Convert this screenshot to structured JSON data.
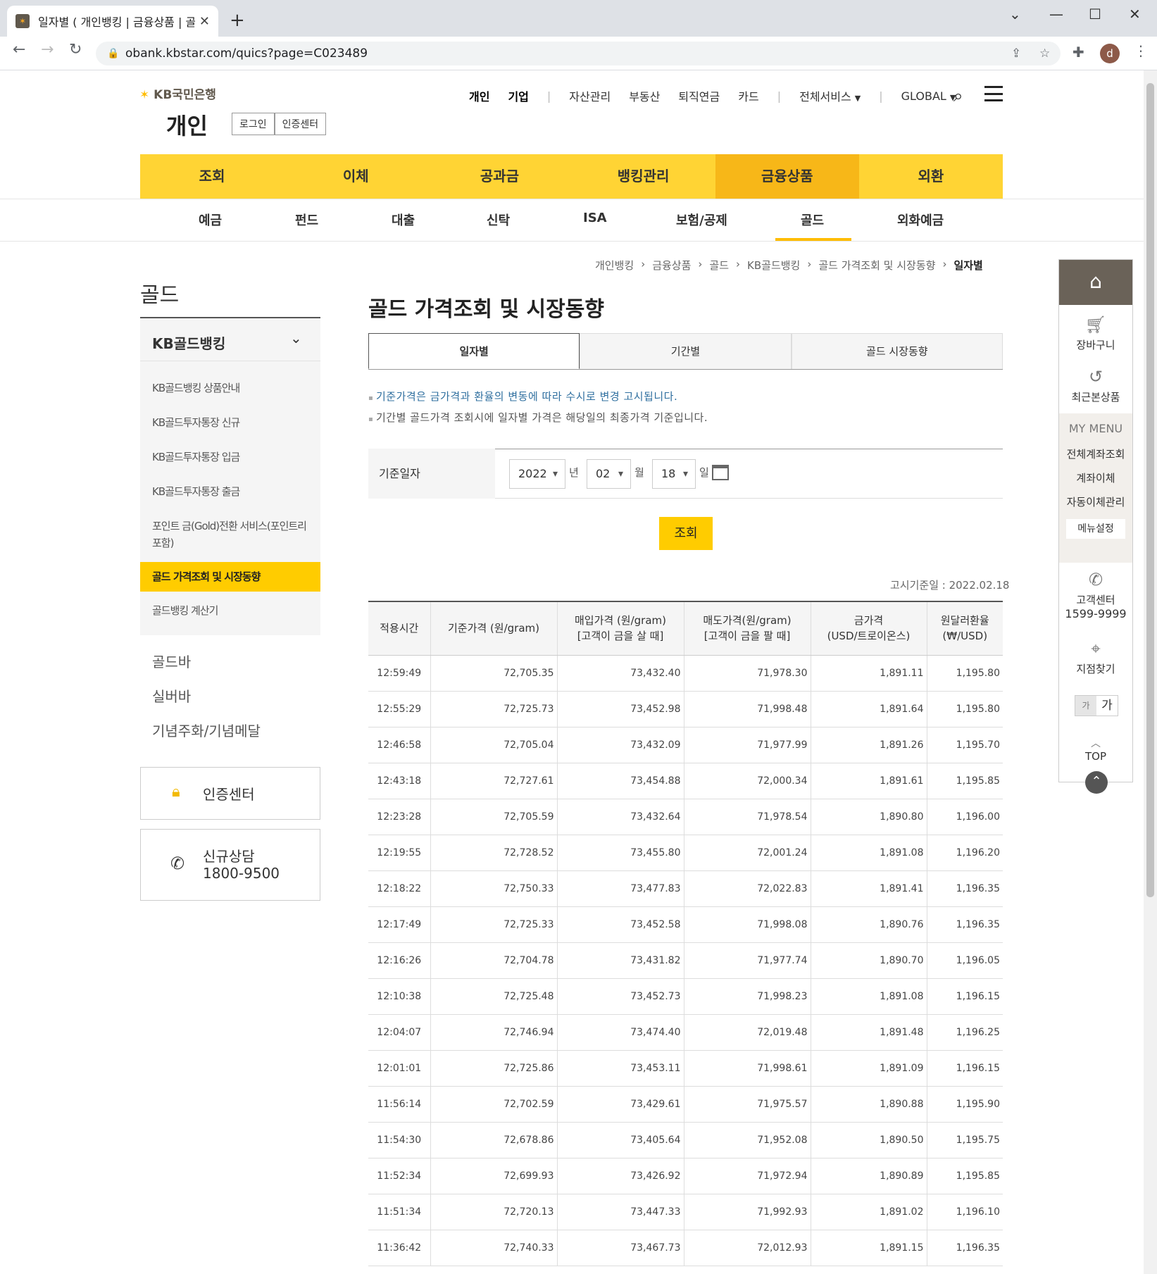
{
  "browser": {
    "tab_title": "일자별 ( 개인뱅킹 | 금융상품 | 골",
    "url": "obank.kbstar.com/quics?page=C023489",
    "profile_initial": "d"
  },
  "header": {
    "bank_name": "KB국민은행",
    "section": "개인",
    "login": "로그인",
    "cert_center": "인증센터",
    "topnav": [
      "개인",
      "기업",
      "자산관리",
      "부동산",
      "퇴직연금",
      "카드",
      "전체서비스",
      "GLOBAL"
    ]
  },
  "gnb": [
    "조회",
    "이체",
    "공과금",
    "뱅킹관리",
    "금융상품",
    "외환"
  ],
  "lnb": [
    "예금",
    "펀드",
    "대출",
    "신탁",
    "ISA",
    "보험/공제",
    "골드",
    "외화예금"
  ],
  "sidebar": {
    "title": "골드",
    "group": "KB골드뱅킹",
    "items": [
      "KB골드뱅킹 상품안내",
      "KB골드투자통장 신규",
      "KB골드투자통장 입금",
      "KB골드투자통장 출금",
      "포인트 금(Gold)전환 서비스(포인트리",
      "포함)",
      "골드 가격조회 및 시장동향",
      "골드뱅킹 계산기"
    ],
    "links": [
      "골드바",
      "실버바",
      "기념주화/기념메달"
    ],
    "cert_box": "인증센터",
    "consult_title": "신규상담",
    "consult_phone": "1800-9500"
  },
  "breadcrumb": [
    "개인뱅킹",
    "금융상품",
    "골드",
    "KB골드뱅킹",
    "골드 가격조회 및 시장동향",
    "일자별"
  ],
  "main": {
    "title": "골드 가격조회 및 시장동향",
    "tabs": [
      "일자별",
      "기간별",
      "골드 시장동향"
    ],
    "notes": [
      "기준가격은 금가격과 환율의 변동에 따라 수시로 변경 고시됩니다.",
      "기간별 골드가격 조회시에 일자별 가격은 해당일의 최종가격 기준입니다."
    ],
    "date_label": "기준일자",
    "year": "2022",
    "year_unit": "년",
    "month": "02",
    "month_unit": "월",
    "day": "18",
    "day_unit": "일",
    "search_button": "조회",
    "notice_date": "고시기준일 : 2022.02.18"
  },
  "table": {
    "headers": [
      [
        "적용시간"
      ],
      [
        "기준가격 (원/gram)"
      ],
      [
        "매입가격 (원/gram)",
        "[고객이 금을 살 때]"
      ],
      [
        "매도가격(원/gram)",
        "[고객이 금을 팔 때]"
      ],
      [
        "금가격",
        "(USD/트로이온스)"
      ],
      [
        "원달러환율",
        "(₩/USD)"
      ]
    ],
    "rows": [
      [
        "12:59:49",
        "72,705.35",
        "73,432.40",
        "71,978.30",
        "1,891.11",
        "1,195.80"
      ],
      [
        "12:55:29",
        "72,725.73",
        "73,452.98",
        "71,998.48",
        "1,891.64",
        "1,195.80"
      ],
      [
        "12:46:58",
        "72,705.04",
        "73,432.09",
        "71,977.99",
        "1,891.26",
        "1,195.70"
      ],
      [
        "12:43:18",
        "72,727.61",
        "73,454.88",
        "72,000.34",
        "1,891.61",
        "1,195.85"
      ],
      [
        "12:23:28",
        "72,705.59",
        "73,432.64",
        "71,978.54",
        "1,890.80",
        "1,196.00"
      ],
      [
        "12:19:55",
        "72,728.52",
        "73,455.80",
        "72,001.24",
        "1,891.08",
        "1,196.20"
      ],
      [
        "12:18:22",
        "72,750.33",
        "73,477.83",
        "72,022.83",
        "1,891.41",
        "1,196.35"
      ],
      [
        "12:17:49",
        "72,725.33",
        "73,452.58",
        "71,998.08",
        "1,890.76",
        "1,196.35"
      ],
      [
        "12:16:26",
        "72,704.78",
        "73,431.82",
        "71,977.74",
        "1,890.70",
        "1,196.05"
      ],
      [
        "12:10:38",
        "72,725.48",
        "73,452.73",
        "71,998.23",
        "1,891.08",
        "1,196.15"
      ],
      [
        "12:04:07",
        "72,746.94",
        "73,474.40",
        "72,019.48",
        "1,891.48",
        "1,196.25"
      ],
      [
        "12:01:01",
        "72,725.86",
        "73,453.11",
        "71,998.61",
        "1,891.09",
        "1,196.15"
      ],
      [
        "11:56:14",
        "72,702.59",
        "73,429.61",
        "71,975.57",
        "1,890.88",
        "1,195.90"
      ],
      [
        "11:54:30",
        "72,678.86",
        "73,405.64",
        "71,952.08",
        "1,890.50",
        "1,195.75"
      ],
      [
        "11:52:34",
        "72,699.93",
        "73,426.92",
        "71,972.94",
        "1,890.89",
        "1,195.85"
      ],
      [
        "11:51:34",
        "72,720.13",
        "73,447.33",
        "71,992.93",
        "1,891.02",
        "1,196.10"
      ],
      [
        "11:36:42",
        "72,740.33",
        "73,467.73",
        "72,012.93",
        "1,891.15",
        "1,196.35"
      ]
    ]
  },
  "quick": {
    "cart": "장바구니",
    "recent": "최근본상품",
    "mymenu": "MY MENU",
    "mymenu_items": [
      "전체계좌조회",
      "계좌이체",
      "자동이체관리"
    ],
    "menu_setting": "메뉴설정",
    "cs": "고객센터",
    "cs_phone": "1599-9999",
    "branch": "지점찾기",
    "font_small": "가",
    "font_large": "가",
    "top": "TOP"
  },
  "colors": {
    "kb_yellow": "#ffcc00",
    "gnb_bg": "#ffd434",
    "gnb_active": "#f7b718",
    "kb_brown": "#60584c"
  }
}
